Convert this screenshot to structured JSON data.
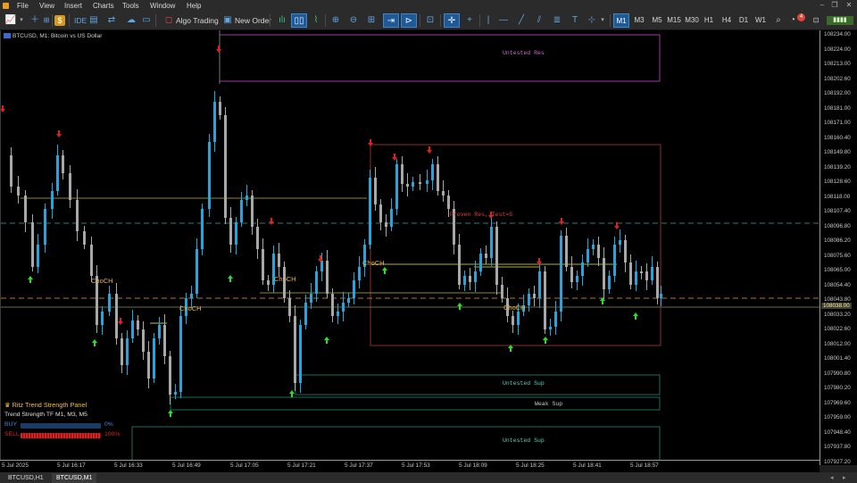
{
  "menu": {
    "items": [
      "File",
      "View",
      "Insert",
      "Charts",
      "Tools",
      "Window",
      "Help"
    ]
  },
  "toolbar": {
    "ide_label": "IDE",
    "algo_trading_label": "Algo Trading",
    "new_order_label": "New Order",
    "timeframes": [
      "M1",
      "M3",
      "M5",
      "M15",
      "M30",
      "H1",
      "H4",
      "D1",
      "W1"
    ],
    "active_timeframe": "M1",
    "notification_count": "4"
  },
  "chart": {
    "symbol_label": "BTCUSD, M1: Bitcoin vs US Dollar",
    "price_labels": [
      "108234.00",
      "108224.00",
      "108213.00",
      "108202.60",
      "108192.00",
      "108181.00",
      "108171.00",
      "108160.40",
      "108149.80",
      "108139.20",
      "108128.60",
      "108118.00",
      "108107.40",
      "108096.80",
      "108086.20",
      "108075.60",
      "108065.00",
      "108054.40",
      "108043.80",
      "108033.20",
      "108022.60",
      "108012.00",
      "108001.40",
      "107990.80",
      "107980.20",
      "107969.60",
      "107959.00",
      "107948.40",
      "107937.80",
      "107927.20"
    ],
    "current_price_label": "108038.00",
    "time_labels": [
      "5 Jul 2025",
      "5 Jul 16:17",
      "5 Jul 16:33",
      "5 Jul 16:49",
      "5 Jul 17:05",
      "5 Jul 17:21",
      "5 Jul 17:37",
      "5 Jul 17:53",
      "5 Jul 18:09",
      "5 Jul 18:25",
      "5 Jul 18:41",
      "5 Jul 18:57"
    ],
    "zones": {
      "untested_res": "Untested Res",
      "proven_res": "Proven Res, Test=5",
      "untested_sup_1": "Untested Sup",
      "weak_sup": "Weak Sup",
      "untested_sup_2": "Untested Sup"
    },
    "choch_label": "ChoCH",
    "colors": {
      "bull": "#1fa8e0",
      "bear": "#a8a8a8",
      "up_arrow": "#28e028",
      "down_arrow": "#e02020",
      "res_zone": "#9a3a9a",
      "proven_zone": "#8a2e2e",
      "sup_zone": "#1f6a5a"
    }
  },
  "panel": {
    "title": "Ritz Trend Strength Panel",
    "subtitle": "Trend Strength TF M1, M3, M5",
    "buy_label": "BUY",
    "buy_value": "0%",
    "sell_label": "SELL",
    "sell_value": "100%",
    "buy_fraction": 0.0,
    "sell_fraction": 1.0
  },
  "tabs": [
    "BTCUSD,H1",
    "BTCUSD,M1"
  ],
  "active_tab": "BTCUSD,M1"
}
